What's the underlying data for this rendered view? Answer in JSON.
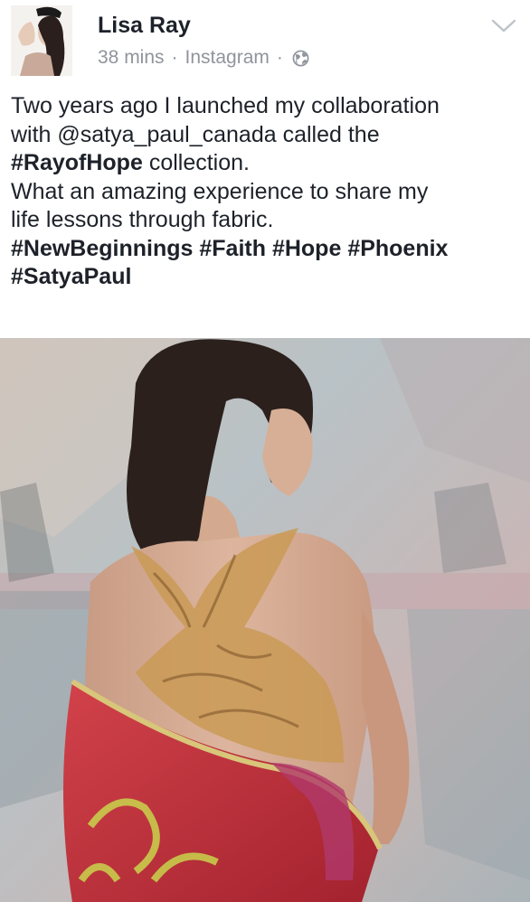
{
  "post": {
    "author": "Lisa Ray",
    "time": "38 mins",
    "source": "Instagram",
    "separator": "·",
    "text": {
      "line1": "Two years ago I launched my collaboration",
      "line2_pre": "with @satya_paul_canada called the",
      "line3_tag": "#RayofHope",
      "line3_post": " collection.",
      "line4": "What an amazing experience to share my",
      "line5": "life lessons through fabric.",
      "hashtags": [
        "#NewBeginnings",
        "#Faith",
        "#Hope",
        "#Phoenix",
        "#SatyaPaul"
      ]
    }
  },
  "icons": {
    "privacy": "globe-icon",
    "menu": "chevron-down-icon"
  },
  "colors": {
    "text": "#1d2129",
    "meta": "#90949c"
  }
}
